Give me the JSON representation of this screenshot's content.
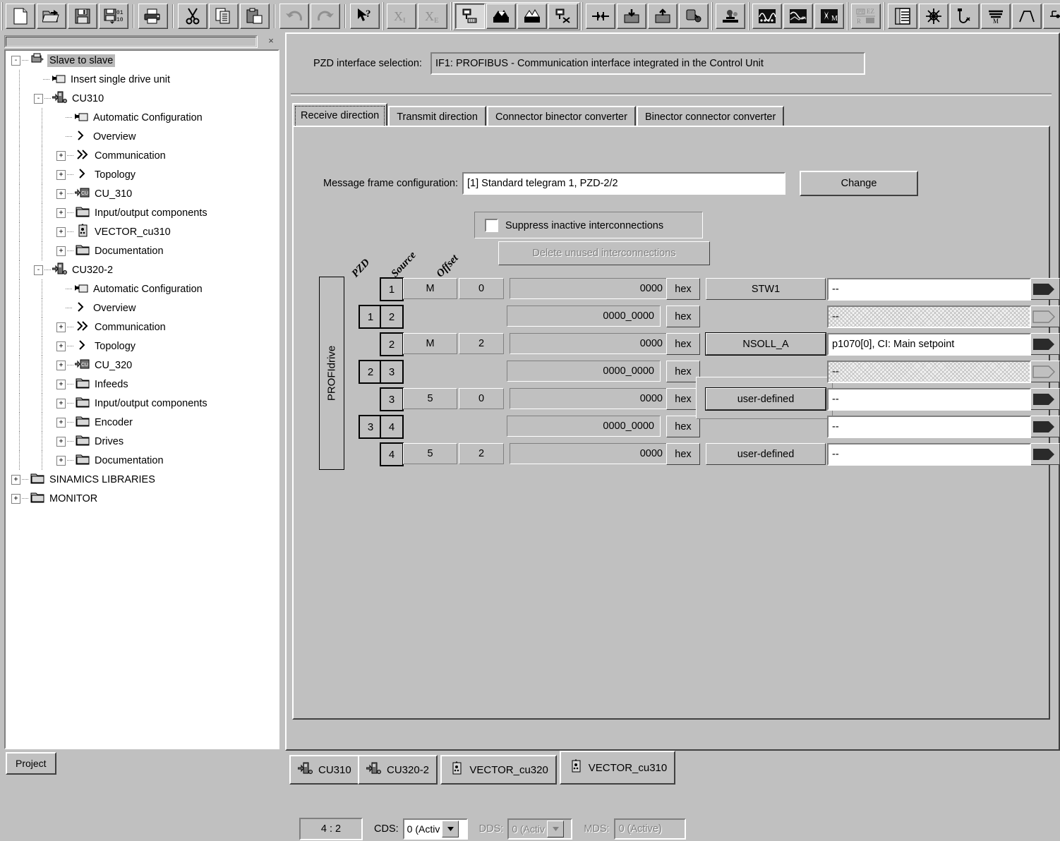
{
  "toolbar": {
    "groups": [
      {
        "buttons": [
          {
            "name": "new-document-icon",
            "label": "New"
          },
          {
            "name": "open-project-icon",
            "label": "Open"
          },
          {
            "name": "save-project-icon",
            "label": "Save"
          },
          {
            "name": "save-compile-icon",
            "label": "Save and compile"
          }
        ]
      },
      {
        "buttons": [
          {
            "name": "print-icon",
            "label": "Print"
          }
        ]
      },
      {
        "buttons": [
          {
            "name": "cut-icon",
            "label": "Cut"
          },
          {
            "name": "copy-icon",
            "label": "Copy"
          },
          {
            "name": "paste-icon",
            "label": "Paste"
          }
        ]
      },
      {
        "buttons": [
          {
            "name": "undo-icon",
            "label": "Undo"
          },
          {
            "name": "redo-icon",
            "label": "Redo"
          }
        ]
      },
      {
        "buttons": [
          {
            "name": "help-pointer-icon",
            "label": "What's this help"
          }
        ]
      },
      {
        "buttons": [
          {
            "name": "expert-list-import-icon",
            "label": "XI"
          },
          {
            "name": "expert-list-export-icon",
            "label": "XE"
          }
        ]
      },
      {
        "framed": true,
        "buttons": [
          {
            "name": "connect-target-system-icon",
            "label": "Connect to target system",
            "pressed": true
          },
          {
            "name": "download-to-target-icon",
            "label": "Download to target system"
          },
          {
            "name": "upload-from-target-icon",
            "label": "Load to PG"
          },
          {
            "name": "disconnect-target-icon",
            "label": "Disconnect from target system"
          }
        ]
      },
      {
        "buttons": [
          {
            "name": "compare-icon",
            "label": "Compare"
          },
          {
            "name": "load-to-filesystem-icon",
            "label": "Copy RAM to ROM"
          },
          {
            "name": "load-from-filesystem-icon",
            "label": "Load from file system"
          },
          {
            "name": "activate-offline-icon",
            "label": "Activate offline mode"
          }
        ]
      },
      {
        "buttons": [
          {
            "name": "diagnostics-overview-icon",
            "label": "Diagnostics overview"
          }
        ]
      },
      {
        "buttons": [
          {
            "name": "topology-tree-icon",
            "label": "Topology"
          }
        ]
      },
      {
        "buttons": [
          {
            "name": "trace-icon",
            "label": "Trace"
          },
          {
            "name": "function-generator-icon",
            "label": "Function generator"
          },
          {
            "name": "measuring-function-icon",
            "label": "Measuring function"
          }
        ]
      },
      {
        "buttons": [
          {
            "name": "ez-report-icon",
            "label": "Report"
          }
        ]
      },
      {
        "buttons": [
          {
            "name": "parameter-list-icon",
            "label": "Expert list"
          },
          {
            "name": "device-trace-icon",
            "label": "Device trace"
          },
          {
            "name": "drive-axis-icon",
            "label": "Drive axis"
          },
          {
            "name": "motor-data-icon",
            "label": "Motor data"
          },
          {
            "name": "ramp-function-icon",
            "label": "Ramp-function generator"
          },
          {
            "name": "signal-flow-icon",
            "label": "Signal flow"
          }
        ]
      }
    ]
  },
  "project_tree": {
    "title": "",
    "close_label": "×",
    "bottom_tab": "Project",
    "nodes": [
      {
        "depth": 0,
        "toggle": "-",
        "icon": "project-icon",
        "label": "Slave to slave",
        "selected": true
      },
      {
        "depth": 1,
        "toggle": "",
        "icon": "insert-arrow-icon",
        "label": "Insert single drive unit"
      },
      {
        "depth": 1,
        "toggle": "-",
        "icon": "control-unit-icon",
        "label": "CU310"
      },
      {
        "depth": 2,
        "toggle": "",
        "icon": "insert-arrow-icon",
        "label": "Automatic Configuration"
      },
      {
        "depth": 2,
        "toggle": "",
        "icon": "chevron-icon",
        "label": "Overview"
      },
      {
        "depth": 2,
        "toggle": "+",
        "icon": "double-chevron-icon",
        "label": "Communication"
      },
      {
        "depth": 2,
        "toggle": "+",
        "icon": "chevron-icon",
        "label": "Topology"
      },
      {
        "depth": 2,
        "toggle": "+",
        "icon": "cu-device-icon",
        "label": "CU_310"
      },
      {
        "depth": 2,
        "toggle": "+",
        "icon": "folder-icon",
        "label": "Input/output components"
      },
      {
        "depth": 2,
        "toggle": "+",
        "icon": "vector-drive-icon",
        "label": "VECTOR_cu310"
      },
      {
        "depth": 2,
        "toggle": "+",
        "icon": "folder-icon",
        "label": "Documentation"
      },
      {
        "depth": 1,
        "toggle": "-",
        "icon": "control-unit-icon",
        "label": "CU320-2"
      },
      {
        "depth": 2,
        "toggle": "",
        "icon": "insert-arrow-icon",
        "label": "Automatic Configuration"
      },
      {
        "depth": 2,
        "toggle": "",
        "icon": "chevron-icon",
        "label": "Overview"
      },
      {
        "depth": 2,
        "toggle": "+",
        "icon": "double-chevron-icon",
        "label": "Communication"
      },
      {
        "depth": 2,
        "toggle": "+",
        "icon": "chevron-icon",
        "label": "Topology"
      },
      {
        "depth": 2,
        "toggle": "+",
        "icon": "cu-device-icon",
        "label": "CU_320"
      },
      {
        "depth": 2,
        "toggle": "+",
        "icon": "folder-icon",
        "label": "Infeeds"
      },
      {
        "depth": 2,
        "toggle": "+",
        "icon": "folder-icon",
        "label": "Input/output components"
      },
      {
        "depth": 2,
        "toggle": "+",
        "icon": "folder-icon",
        "label": "Encoder"
      },
      {
        "depth": 2,
        "toggle": "+",
        "icon": "folder-icon",
        "label": "Drives"
      },
      {
        "depth": 2,
        "toggle": "+",
        "icon": "folder-icon",
        "label": "Documentation"
      },
      {
        "depth": 0,
        "toggle": "+",
        "icon": "folder-icon",
        "label": "SINAMICS LIBRARIES"
      },
      {
        "depth": 0,
        "toggle": "+",
        "icon": "folder-icon",
        "label": "MONITOR"
      }
    ]
  },
  "main": {
    "pzd_interface_label": "PZD interface selection:",
    "pzd_interface_value": "IF1:  PROFIBUS - Communication interface integrated in the Control Unit",
    "tabs": [
      {
        "label": "Receive direction",
        "active": true
      },
      {
        "label": "Transmit direction",
        "active": false
      },
      {
        "label": "Connector binector converter",
        "active": false
      },
      {
        "label": "Binector connector converter",
        "active": false
      }
    ],
    "message_frame_label": "Message frame configuration:",
    "message_frame_value": "[1] Standard telegram 1, PZD-2/2",
    "change_button": "Change",
    "suppress_checkbox_label": "Suppress inactive interconnections",
    "suppress_checked": false,
    "delete_button": "Delete unused interconnections",
    "delete_button_disabled": true,
    "column_headers": [
      "PZD",
      "Source",
      "Offset"
    ],
    "row_group_label": "PROFIdrive",
    "hex_button_label": "hex",
    "rows": [
      {
        "span": "",
        "pzd": "1",
        "source": "M",
        "offset": "0",
        "value": "0000",
        "hex": "hex",
        "name": "STW1",
        "name_style": "raised",
        "interconnect": "--",
        "arrow": "filled",
        "stack": true
      },
      {
        "span": "1",
        "pzd": "2",
        "source": "",
        "offset": "",
        "value": "0000_0000",
        "hex": "hex",
        "name": "",
        "name_style": "none",
        "interconnect": "--",
        "interconnect_style": "hatched",
        "arrow": "empty",
        "stack": false
      },
      {
        "span": "",
        "pzd": "2",
        "source": "M",
        "offset": "2",
        "value": "0000",
        "hex": "hex",
        "name": "NSOLL_A",
        "name_style": "outlined",
        "interconnect": "p1070[0], CI: Main setpoint",
        "arrow": "filled",
        "stack": true
      },
      {
        "span": "2",
        "pzd": "3",
        "source": "",
        "offset": "",
        "value": "0000_0000",
        "hex": "hex",
        "name": "",
        "name_style": "none",
        "interconnect": "--",
        "interconnect_style": "hatched",
        "arrow": "empty",
        "stack": false
      },
      {
        "span": "",
        "pzd": "3",
        "source": "5",
        "offset": "0",
        "value": "0000",
        "hex": "hex",
        "name": "user-defined",
        "name_style": "outlined",
        "interconnect": "--",
        "arrow": "filled",
        "stack": true,
        "float_panel": true
      },
      {
        "span": "3",
        "pzd": "4",
        "source": "",
        "offset": "",
        "value": "0000_0000",
        "hex": "hex",
        "name": "",
        "name_style": "none",
        "interconnect": "--",
        "arrow": "filled",
        "stack": false
      },
      {
        "span": "",
        "pzd": "4",
        "source": "5",
        "offset": "2",
        "value": "0000",
        "hex": "hex",
        "name": "user-defined",
        "name_style": "raised",
        "interconnect": "--",
        "arrow": "filled",
        "stack": true
      }
    ],
    "status": {
      "ratio": "4 : 2",
      "cds_label": "CDS:",
      "cds_value": "0 (Activ",
      "dds_label": "DDS:",
      "dds_value": "0 (Activ",
      "dds_disabled": true,
      "mds_label": "MDS:",
      "mds_value": "0 (Active)",
      "mds_disabled": true
    }
  },
  "doc_tabs": [
    {
      "label": "CU310",
      "icon": "control-unit-icon",
      "active": false
    },
    {
      "label": "CU320-2",
      "icon": "control-unit-icon",
      "active": false
    },
    {
      "label": "VECTOR_cu320",
      "icon": "vector-drive-icon",
      "active": false
    },
    {
      "label": "VECTOR_cu310",
      "icon": "vector-drive-icon",
      "active": true
    }
  ]
}
